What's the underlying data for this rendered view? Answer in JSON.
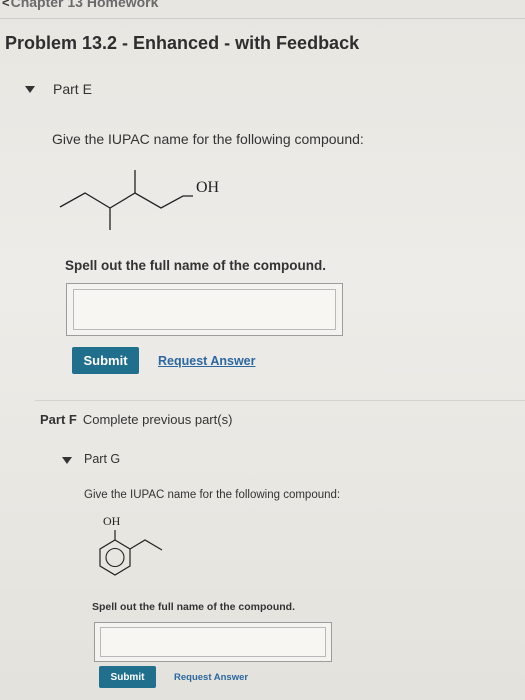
{
  "header": {
    "chevron": "<",
    "breadcrumb": "Chapter 13 Homework"
  },
  "problem": {
    "title": "Problem 13.2 - Enhanced - with Feedback"
  },
  "part_e": {
    "label": "Part E",
    "prompt": "Give the IUPAC name for the following compound:",
    "structure_label": "OH",
    "instruction": "Spell out the full name of the compound.",
    "answer_value": "",
    "submit_label": "Submit",
    "request_label": "Request Answer"
  },
  "part_f": {
    "label": "Part F",
    "status": "Complete previous part(s)"
  },
  "part_g": {
    "label": "Part G",
    "prompt": "Give the IUPAC name for the following compound:",
    "structure_label": "OH",
    "instruction": "Spell out the full name of the compound.",
    "answer_value": "",
    "submit_label": "Submit",
    "request_label": "Request Answer"
  },
  "colors": {
    "submit_bg": "#206f8c",
    "link": "#2b68a0"
  }
}
